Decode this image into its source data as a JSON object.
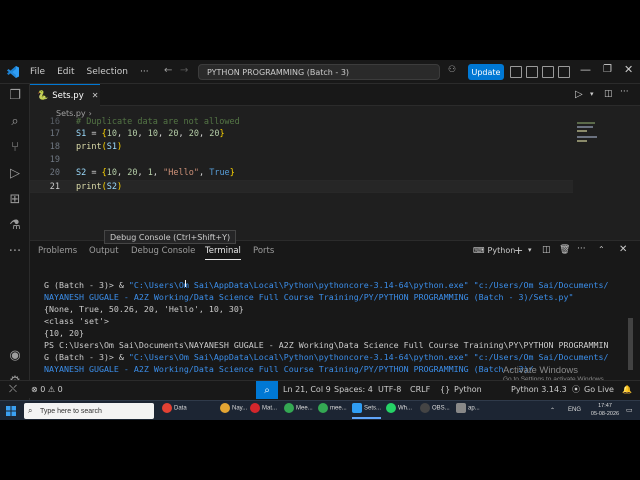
{
  "titlebar": {
    "menus": [
      "File",
      "Edit",
      "Selection"
    ],
    "command_center": "PYTHON PROGRAMMING (Batch - 3)",
    "update_label": "Update"
  },
  "editor": {
    "tab_name": "Sets.py",
    "breadcrumb": "Sets.py",
    "lines": [
      {
        "num": "16",
        "text": "# Duplicate data are not allowed"
      },
      {
        "num": "17",
        "text": "S1 = {10, 10, 10, 20, 20, 20}"
      },
      {
        "num": "18",
        "text": "print(S1)"
      },
      {
        "num": "19",
        "text": ""
      },
      {
        "num": "20",
        "text": "S2 = {10, 20, 1, \"Hello\", True}"
      },
      {
        "num": "21",
        "text": "print(S2)"
      }
    ],
    "tooltip": "Debug Console (Ctrl+Shift+Y)"
  },
  "panel": {
    "tabs": [
      "Problems",
      "Output",
      "Debug Console",
      "Terminal",
      "Ports"
    ],
    "active_tab": "Terminal",
    "terminal_kind": "Python",
    "terminal_lines": [
      {
        "prefix": "G (Batch - 3)> & ",
        "path": "\"C:\\Users\\Om Sai\\AppData\\Local\\Python\\pythoncore-3.14-64\\python.exe\" \"c:/Users/Om Sai/Documents/"
      },
      {
        "prefix": "",
        "path": "NAYANESH GUGALE - A2Z Working/Data Science Full Course Training/PY/PYTHON PROGRAMMING (Batch - 3)/Sets.py\""
      },
      {
        "prefix": "{None, True, 50.26, 20, 'Hello', 10, 30}",
        "path": ""
      },
      {
        "prefix": "<class 'set'>",
        "path": ""
      },
      {
        "prefix": "{10, 20}",
        "path": ""
      },
      {
        "prefix": "PS C:\\Users\\Om Sai\\Documents\\NAYANESH GUGALE - A2Z Working\\Data Science Full Course Training\\PY\\PYTHON PROGRAMMIN",
        "path": ""
      },
      {
        "prefix": "G (Batch - 3)> & ",
        "path": "\"C:\\Users\\Om Sai\\AppData\\Local\\Python\\pythoncore-3.14-64\\python.exe\" \"c:/Users/Om Sai/Documents/"
      },
      {
        "prefix": "",
        "path": "NAYANESH GUGALE - A2Z Working/Data Science Full Course Training/PY/PYTHON PROGRAMMING (Batch - 3)/"
      }
    ],
    "watermark_title": "Activate Windows",
    "watermark_sub": "Go to Settings to activate Windows."
  },
  "statusbar": {
    "problems": "⊗ 0 ⚠ 0",
    "accounts_badge": "1",
    "position": "Ln 21, Col 9",
    "spaces": "Spaces: 4",
    "encoding": "UTF-8",
    "eol": "CRLF",
    "language": "Python",
    "interpreter": "Python 3.14.3",
    "go_live": "Go Live"
  },
  "taskbar": {
    "search_placeholder": "Type here to search",
    "apps": [
      "Data",
      "Nay...",
      "Mat...",
      "Mee...",
      "mee...",
      "Sets...",
      "Wh...",
      "OBS...",
      "ap..."
    ],
    "lang": "ENG",
    "time": "17:47",
    "date": "05-08-2026"
  },
  "colors": {
    "accent": "#0078d4",
    "editor_bg": "#1f1f1f",
    "chrome_bg": "#181818",
    "terminal_path": "#3b8eea"
  }
}
